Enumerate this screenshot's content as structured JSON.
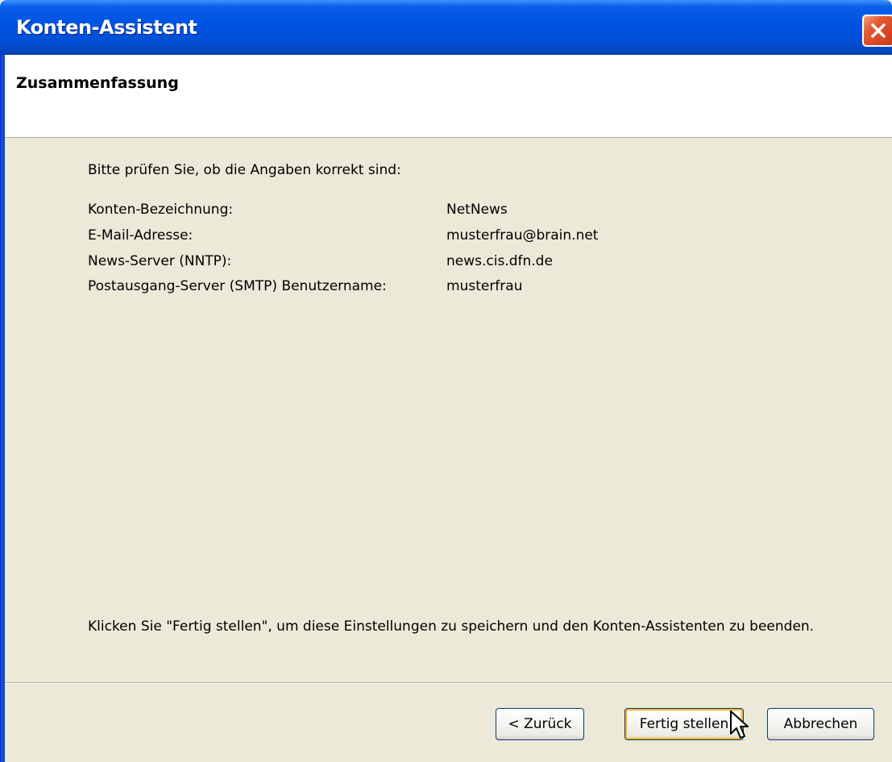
{
  "window": {
    "title": "Konten-Assistent"
  },
  "header": {
    "title": "Zusammenfassung"
  },
  "content": {
    "intro": "Bitte prüfen Sie, ob die Angaben korrekt sind:",
    "summary": [
      {
        "label": "Konten-Bezeichnung:",
        "value": "NetNews"
      },
      {
        "label": "E-Mail-Adresse:",
        "value": "musterfrau@brain.net"
      },
      {
        "label": "News-Server (NNTP):",
        "value": "news.cis.dfn.de"
      },
      {
        "label": "Postausgang-Server (SMTP) Benutzername:",
        "value": "musterfrau"
      }
    ],
    "finish_note": "Klicken Sie \"Fertig stellen\", um diese Einstellungen zu speichern und den Konten-Assistenten zu beenden."
  },
  "buttons": {
    "back": "< Zurück",
    "finish": "Fertig stellen",
    "cancel": "Abbrechen"
  },
  "icons": {
    "close": "close-icon",
    "cursor": "mouse-pointer-icon"
  },
  "colors": {
    "titlebar": "#0054e3",
    "dialog_bg": "#ece9d8",
    "close_button": "#e2582f",
    "default_button_focus": "#f8b330"
  }
}
